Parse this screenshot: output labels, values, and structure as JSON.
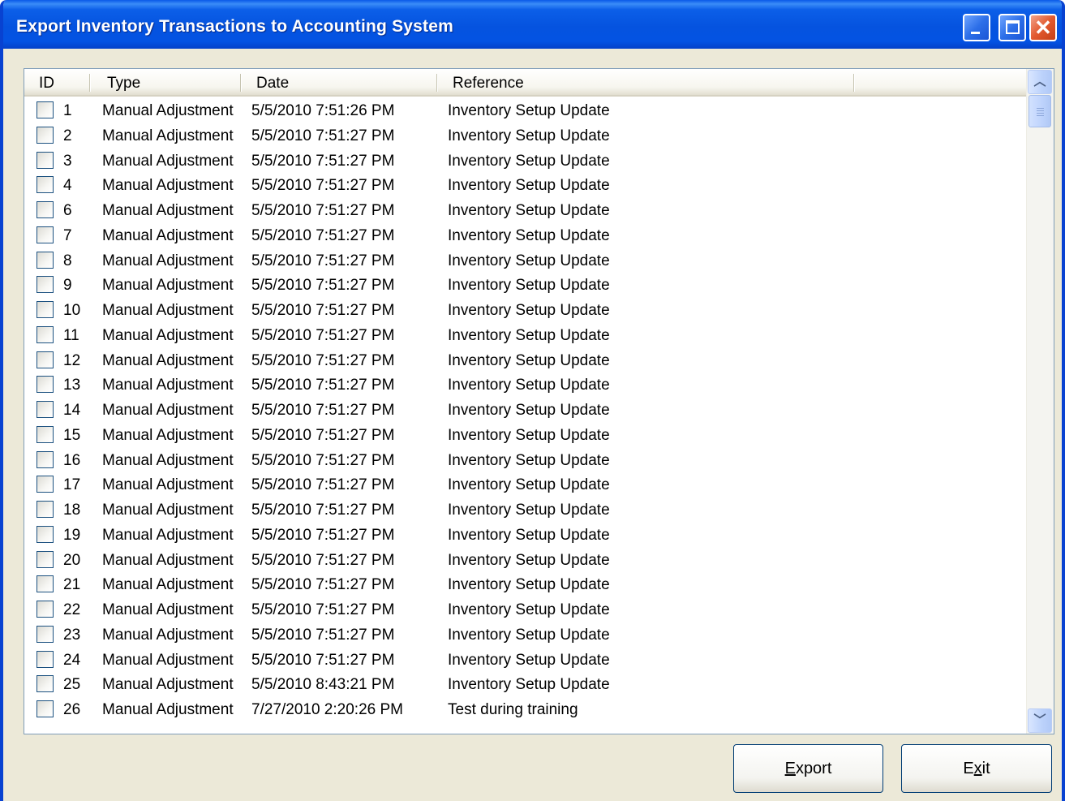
{
  "window": {
    "title": "Export Inventory Transactions to Accounting System"
  },
  "listview": {
    "columns": [
      "ID",
      "Type",
      "Date",
      "Reference"
    ],
    "rows": [
      {
        "id": "1",
        "type": "Manual Adjustment",
        "date": "5/5/2010 7:51:26 PM",
        "reference": "Inventory Setup Update",
        "checked": false
      },
      {
        "id": "2",
        "type": "Manual Adjustment",
        "date": "5/5/2010 7:51:27 PM",
        "reference": "Inventory Setup Update",
        "checked": false
      },
      {
        "id": "3",
        "type": "Manual Adjustment",
        "date": "5/5/2010 7:51:27 PM",
        "reference": "Inventory Setup Update",
        "checked": false
      },
      {
        "id": "4",
        "type": "Manual Adjustment",
        "date": "5/5/2010 7:51:27 PM",
        "reference": "Inventory Setup Update",
        "checked": false
      },
      {
        "id": "6",
        "type": "Manual Adjustment",
        "date": "5/5/2010 7:51:27 PM",
        "reference": "Inventory Setup Update",
        "checked": false
      },
      {
        "id": "7",
        "type": "Manual Adjustment",
        "date": "5/5/2010 7:51:27 PM",
        "reference": "Inventory Setup Update",
        "checked": false
      },
      {
        "id": "8",
        "type": "Manual Adjustment",
        "date": "5/5/2010 7:51:27 PM",
        "reference": "Inventory Setup Update",
        "checked": false
      },
      {
        "id": "9",
        "type": "Manual Adjustment",
        "date": "5/5/2010 7:51:27 PM",
        "reference": "Inventory Setup Update",
        "checked": false
      },
      {
        "id": "10",
        "type": "Manual Adjustment",
        "date": "5/5/2010 7:51:27 PM",
        "reference": "Inventory Setup Update",
        "checked": false
      },
      {
        "id": "11",
        "type": "Manual Adjustment",
        "date": "5/5/2010 7:51:27 PM",
        "reference": "Inventory Setup Update",
        "checked": false
      },
      {
        "id": "12",
        "type": "Manual Adjustment",
        "date": "5/5/2010 7:51:27 PM",
        "reference": "Inventory Setup Update",
        "checked": false
      },
      {
        "id": "13",
        "type": "Manual Adjustment",
        "date": "5/5/2010 7:51:27 PM",
        "reference": "Inventory Setup Update",
        "checked": false
      },
      {
        "id": "14",
        "type": "Manual Adjustment",
        "date": "5/5/2010 7:51:27 PM",
        "reference": "Inventory Setup Update",
        "checked": false
      },
      {
        "id": "15",
        "type": "Manual Adjustment",
        "date": "5/5/2010 7:51:27 PM",
        "reference": "Inventory Setup Update",
        "checked": false
      },
      {
        "id": "16",
        "type": "Manual Adjustment",
        "date": "5/5/2010 7:51:27 PM",
        "reference": "Inventory Setup Update",
        "checked": false
      },
      {
        "id": "17",
        "type": "Manual Adjustment",
        "date": "5/5/2010 7:51:27 PM",
        "reference": "Inventory Setup Update",
        "checked": false
      },
      {
        "id": "18",
        "type": "Manual Adjustment",
        "date": "5/5/2010 7:51:27 PM",
        "reference": "Inventory Setup Update",
        "checked": false
      },
      {
        "id": "19",
        "type": "Manual Adjustment",
        "date": "5/5/2010 7:51:27 PM",
        "reference": "Inventory Setup Update",
        "checked": false
      },
      {
        "id": "20",
        "type": "Manual Adjustment",
        "date": "5/5/2010 7:51:27 PM",
        "reference": "Inventory Setup Update",
        "checked": false
      },
      {
        "id": "21",
        "type": "Manual Adjustment",
        "date": "5/5/2010 7:51:27 PM",
        "reference": "Inventory Setup Update",
        "checked": false
      },
      {
        "id": "22",
        "type": "Manual Adjustment",
        "date": "5/5/2010 7:51:27 PM",
        "reference": "Inventory Setup Update",
        "checked": false
      },
      {
        "id": "23",
        "type": "Manual Adjustment",
        "date": "5/5/2010 7:51:27 PM",
        "reference": "Inventory Setup Update",
        "checked": false
      },
      {
        "id": "24",
        "type": "Manual Adjustment",
        "date": "5/5/2010 7:51:27 PM",
        "reference": "Inventory Setup Update",
        "checked": false
      },
      {
        "id": "25",
        "type": "Manual Adjustment",
        "date": "5/5/2010 8:43:21 PM",
        "reference": "Inventory Setup Update",
        "checked": false
      },
      {
        "id": "26",
        "type": "Manual Adjustment",
        "date": "7/27/2010 2:20:26 PM",
        "reference": "Test during training",
        "checked": false
      }
    ]
  },
  "scrollbar": {
    "up_icon": "scroll-up-arrow",
    "down_icon": "scroll-down-arrow"
  },
  "buttons": {
    "export_mnemonic": "E",
    "export_rest": "xport",
    "exit_first": "E",
    "exit_mnemonic": "x",
    "exit_rest": "it"
  },
  "colors": {
    "titlebar": "#0553df",
    "frame": "#0842d1",
    "dialog_bg": "#ece9d8",
    "close_button": "#e2592f"
  }
}
